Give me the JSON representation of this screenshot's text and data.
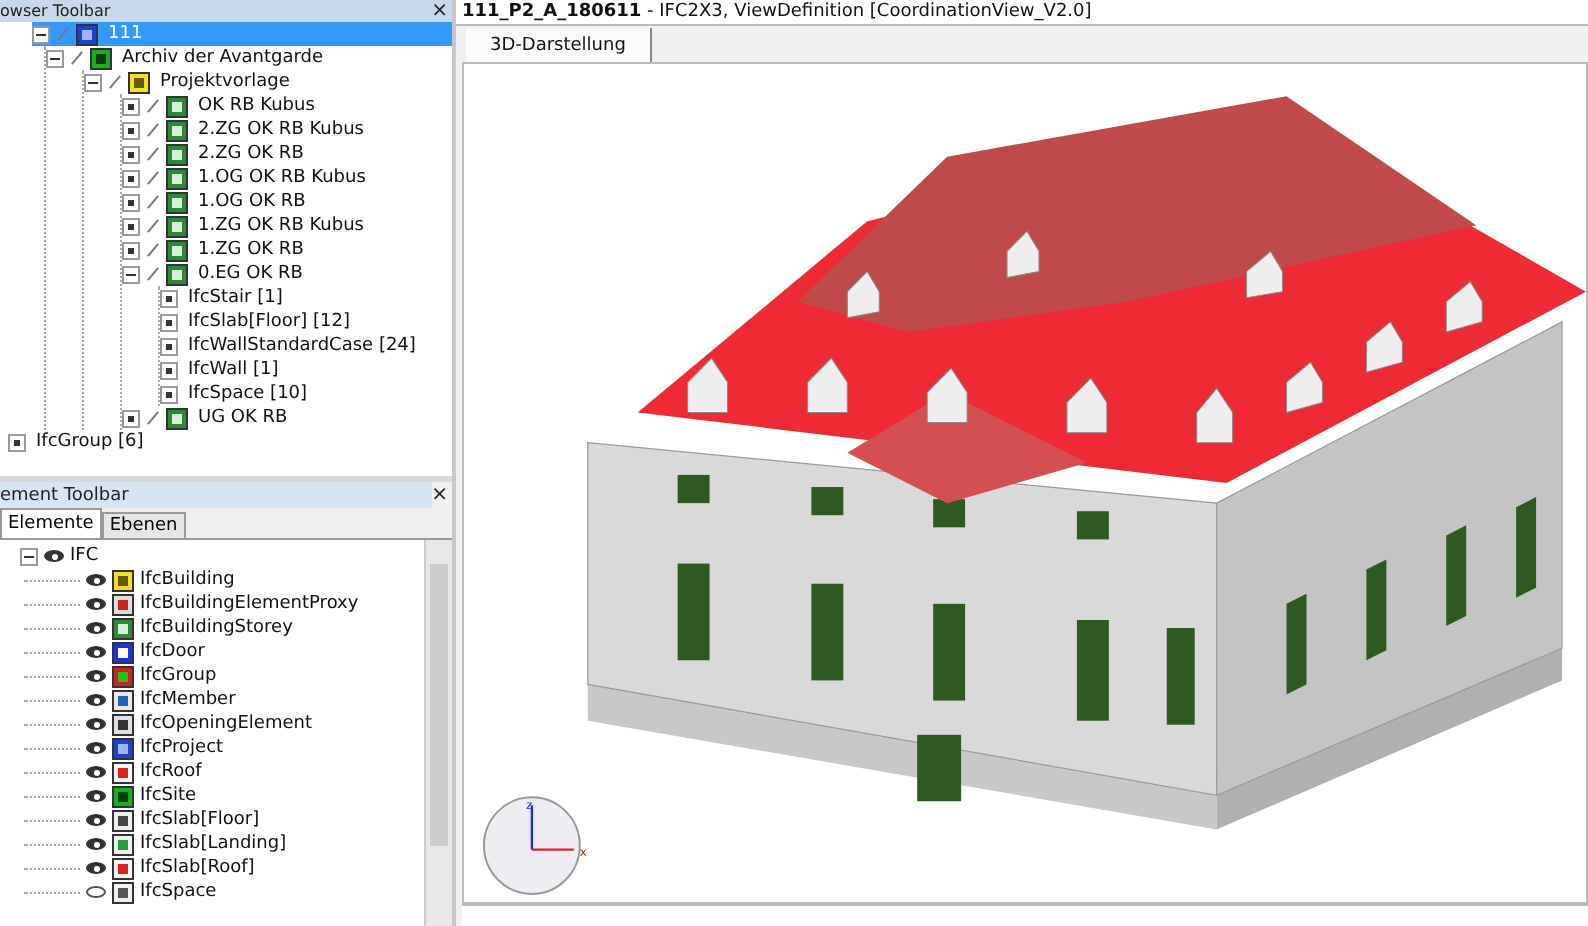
{
  "browser_panel": {
    "title": "owser Toolbar",
    "close": "×",
    "tree": [
      {
        "label": "111",
        "kind": "project",
        "selected": true,
        "expanded": true,
        "children": [
          {
            "label": "Archiv der Avantgarde",
            "kind": "site",
            "selected": false,
            "expanded": true,
            "children": [
              {
                "label": "Projektvorlage",
                "kind": "building",
                "selected": false,
                "expanded": true,
                "children": [
                  {
                    "label": "OK RB Kubus",
                    "kind": "storey",
                    "selected": false,
                    "expanded": false
                  },
                  {
                    "label": "2.ZG OK RB Kubus",
                    "kind": "storey",
                    "selected": false,
                    "expanded": false
                  },
                  {
                    "label": "2.ZG OK RB",
                    "kind": "storey",
                    "selected": false,
                    "expanded": false
                  },
                  {
                    "label": "1.OG OK RB Kubus",
                    "kind": "storey",
                    "selected": false,
                    "expanded": false
                  },
                  {
                    "label": "1.OG OK RB",
                    "kind": "storey",
                    "selected": false,
                    "expanded": false
                  },
                  {
                    "label": "1.ZG OK RB Kubus",
                    "kind": "storey",
                    "selected": false,
                    "expanded": false
                  },
                  {
                    "label": "1.ZG OK RB",
                    "kind": "storey",
                    "selected": false,
                    "expanded": false
                  },
                  {
                    "label": "0.EG OK RB",
                    "kind": "storey",
                    "selected": false,
                    "expanded": true,
                    "children": [
                      {
                        "label": "IfcStair [1]",
                        "selected": false,
                        "expanded": false
                      },
                      {
                        "label": "IfcSlab[Floor] [12]",
                        "selected": false,
                        "expanded": false
                      },
                      {
                        "label": "IfcWallStandardCase [24]",
                        "selected": false,
                        "expanded": false
                      },
                      {
                        "label": "IfcWall [1]",
                        "selected": false,
                        "expanded": false
                      },
                      {
                        "label": "IfcSpace [10]",
                        "selected": false,
                        "expanded": false
                      }
                    ]
                  },
                  {
                    "label": "UG OK RB",
                    "kind": "storey",
                    "selected": false,
                    "expanded": false
                  }
                ]
              }
            ]
          }
        ]
      },
      {
        "label": "IfcGroup [6]",
        "selected": false,
        "expanded": false
      }
    ]
  },
  "element_panel": {
    "title": "ement Toolbar",
    "close": "×",
    "tabs": [
      {
        "label": "Elemente",
        "selected": true
      },
      {
        "label": "Ebenen",
        "selected": false
      }
    ],
    "root": {
      "label": "IFC",
      "visible": true,
      "expanded": true
    },
    "items": [
      {
        "label": "IfcBuilding",
        "kind": "building",
        "visible": true
      },
      {
        "label": "IfcBuildingElementProxy",
        "kind": "proxy",
        "visible": true
      },
      {
        "label": "IfcBuildingStorey",
        "kind": "storey",
        "visible": true
      },
      {
        "label": "IfcDoor",
        "kind": "door",
        "visible": true
      },
      {
        "label": "IfcGroup",
        "kind": "group",
        "visible": true
      },
      {
        "label": "IfcMember",
        "kind": "member",
        "visible": true
      },
      {
        "label": "IfcOpeningElement",
        "kind": "opening",
        "visible": true
      },
      {
        "label": "IfcProject",
        "kind": "project",
        "visible": true
      },
      {
        "label": "IfcRoof",
        "kind": "roof",
        "visible": true
      },
      {
        "label": "IfcSite",
        "kind": "site",
        "visible": true
      },
      {
        "label": "IfcSlab[Floor]",
        "kind": "slab",
        "visible": true
      },
      {
        "label": "IfcSlab[Landing]",
        "kind": "landing",
        "visible": true
      },
      {
        "label": "IfcSlab[Roof]",
        "kind": "roof",
        "visible": true
      },
      {
        "label": "IfcSpace",
        "kind": "space",
        "visible": false
      }
    ]
  },
  "viewer": {
    "title": "**111_P2_A_180611** - IFC2X3, ViewDefinition [CoordinationView_V2.0]",
    "tabs": [
      {
        "label": "3D-Darstellung",
        "selected": true
      }
    ],
    "axis_labels": {
      "z": "z",
      "x": "x"
    }
  }
}
